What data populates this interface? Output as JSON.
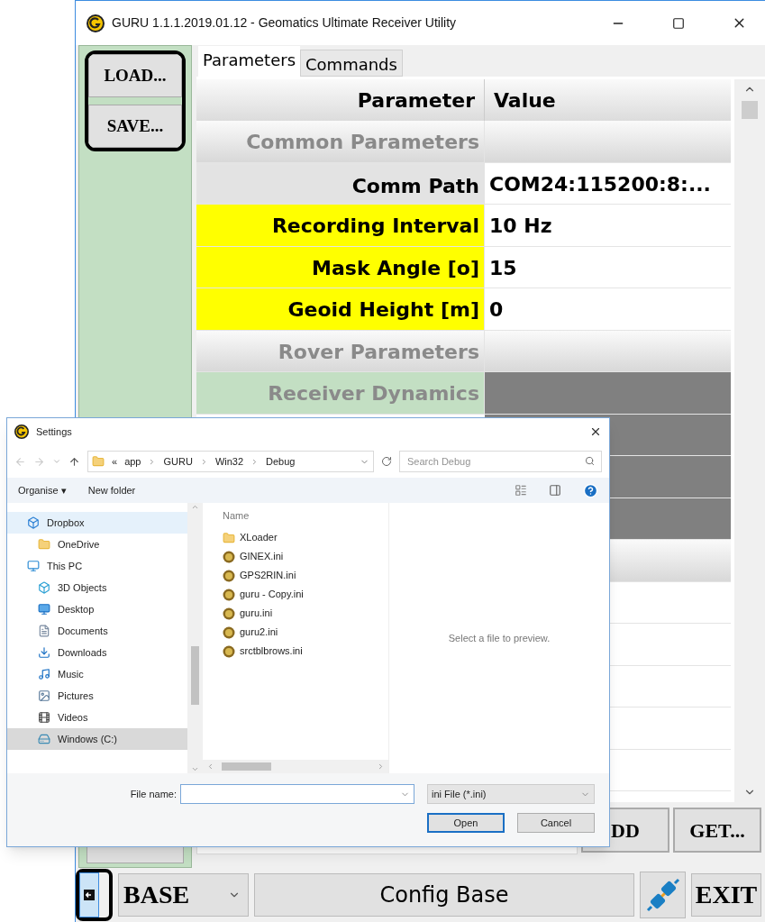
{
  "window": {
    "title": "GURU 1.1.1.2019.01.12 - Geomatics Ultimate Receiver Utility"
  },
  "sidebar": {
    "buttons": [
      "LOAD...",
      "SAVE..."
    ]
  },
  "tabs": [
    {
      "label": "Parameters",
      "selected": true
    },
    {
      "label": "Commands",
      "selected": false
    }
  ],
  "table": {
    "columns": [
      "Parameter",
      "Value"
    ],
    "rows": [
      {
        "kind": "section",
        "parameter": "Common Parameters"
      },
      {
        "kind": "focused",
        "parameter": "Comm Path",
        "value": "COM24:115200:8:..."
      },
      {
        "kind": "required",
        "parameter": "Recording Interval",
        "value": "10 Hz"
      },
      {
        "kind": "required",
        "parameter": "Mask Angle [o]",
        "value": "15"
      },
      {
        "kind": "required",
        "parameter": "Geoid Height [m]",
        "value": "0"
      },
      {
        "kind": "section",
        "parameter": "Rover Parameters"
      },
      {
        "kind": "locked",
        "parameter": "Receiver Dynamics"
      },
      {
        "kind": "locked"
      },
      {
        "kind": "locked"
      },
      {
        "kind": "locked"
      },
      {
        "kind": "section"
      },
      {
        "kind": "blank"
      },
      {
        "kind": "blank"
      },
      {
        "kind": "blank"
      },
      {
        "kind": "blank"
      },
      {
        "kind": "blank"
      }
    ]
  },
  "action_buttons": [
    "DD",
    "GET..."
  ],
  "bottom_bar": {
    "mode": "BASE",
    "config_button": "Config Base",
    "exit_button": "EXIT"
  },
  "dialog": {
    "title": "Settings",
    "breadcrumb": [
      "«",
      "app",
      "GURU",
      "Win32",
      "Debug"
    ],
    "search": {
      "placeholder": "Search Debug"
    },
    "toolbar": {
      "organise": "Organise ▾",
      "new_folder": "New folder"
    },
    "nav": [
      {
        "label": "Dropbox",
        "kind": "dropbox",
        "selected": false,
        "hovered": true
      },
      {
        "label": "OneDrive",
        "kind": "folder",
        "selected": false,
        "hovered": false
      },
      {
        "label": "This PC",
        "kind": "pc",
        "selected": false,
        "hovered": false
      },
      {
        "label": "3D Objects",
        "kind": "cube",
        "selected": false,
        "hovered": false
      },
      {
        "label": "Desktop",
        "kind": "desktop",
        "selected": false,
        "hovered": false
      },
      {
        "label": "Documents",
        "kind": "document",
        "selected": false,
        "hovered": false
      },
      {
        "label": "Downloads",
        "kind": "download",
        "selected": false,
        "hovered": false
      },
      {
        "label": "Music",
        "kind": "music",
        "selected": false,
        "hovered": false
      },
      {
        "label": "Pictures",
        "kind": "pictures",
        "selected": false,
        "hovered": false
      },
      {
        "label": "Videos",
        "kind": "videos",
        "selected": false,
        "hovered": false
      },
      {
        "label": "Windows (C:)",
        "kind": "drive",
        "selected": true,
        "hovered": false
      }
    ],
    "column": "Name",
    "files": [
      {
        "name": "XLoader",
        "kind": "folder"
      },
      {
        "name": "GINEX.ini",
        "kind": "ini"
      },
      {
        "name": "GPS2RIN.ini",
        "kind": "ini"
      },
      {
        "name": "guru - Copy.ini",
        "kind": "ini"
      },
      {
        "name": "guru.ini",
        "kind": "ini"
      },
      {
        "name": "guru2.ini",
        "kind": "ini"
      },
      {
        "name": "srctblbrows.ini",
        "kind": "ini"
      }
    ],
    "preview": "Select a file to preview.",
    "file_name_label": "File name:",
    "file_type": "ini File (*.ini)",
    "buttons": [
      "Open",
      "Cancel"
    ]
  }
}
